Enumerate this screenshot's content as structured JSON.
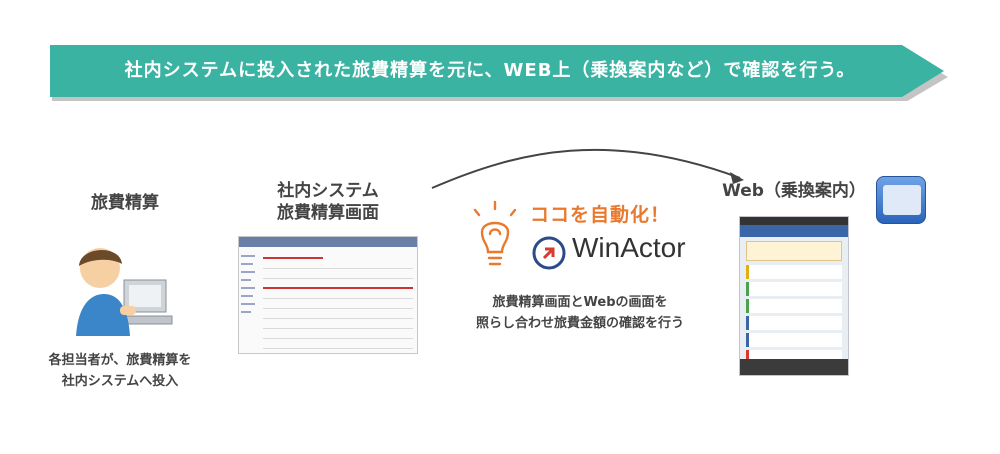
{
  "banner": {
    "text": "社内システムに投入された旅費精算を元に、WEB上（乗換案内など）で確認を行う。",
    "color": "#3bb3a3"
  },
  "step1": {
    "title": "旅費精算",
    "caption_line1": "各担当者が、旅費精算を",
    "caption_line2": "社内システムへ投入"
  },
  "step2": {
    "title_line1": "社内システム",
    "title_line2": "旅費精算画面"
  },
  "center": {
    "automate": "ココを自動化！",
    "logo_text": "WinActor",
    "caption_line1": "旅費精算画面とWebの画面を",
    "caption_line2": "照らし合わせ旅費金額の確認を行う",
    "accent_color": "#e8792e"
  },
  "step3": {
    "title": "Web（乗換案内）"
  },
  "icons": [
    "person-at-computer-icon",
    "light-bulb-icon",
    "winactor-logo-icon",
    "ekitan-app-icon",
    "arrow-icon"
  ]
}
